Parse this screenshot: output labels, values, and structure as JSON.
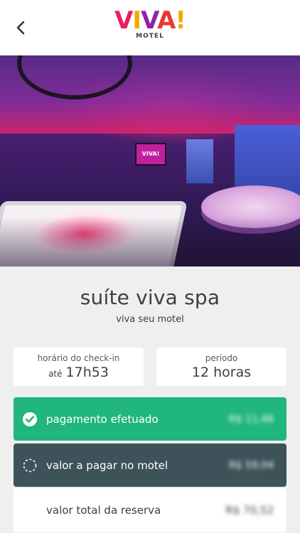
{
  "header": {
    "back_icon": "chevron-left-icon",
    "logo_text": "VIVA!",
    "logo_letters": [
      "V",
      "I",
      "V",
      "A",
      "!"
    ],
    "logo_sub": "MOTEL"
  },
  "hero": {
    "tv_logo": "VIVA!"
  },
  "suite": {
    "title": "suíte viva spa",
    "subtitle": "viva seu motel"
  },
  "checkin": {
    "label": "horário do check-in",
    "prefix": "até",
    "time": "17h53"
  },
  "period": {
    "label": "período",
    "value": "12 horas"
  },
  "payments": {
    "paid_label": "pagamento efetuado",
    "paid_amount": "R$ 11,48",
    "paid_color": "#21b57f",
    "due_label": "valor a pagar no motel",
    "due_amount": "R$ 59,04",
    "due_color": "#3e5259",
    "total_label": "valor total da reserva",
    "total_amount": "R$ 70,52"
  }
}
